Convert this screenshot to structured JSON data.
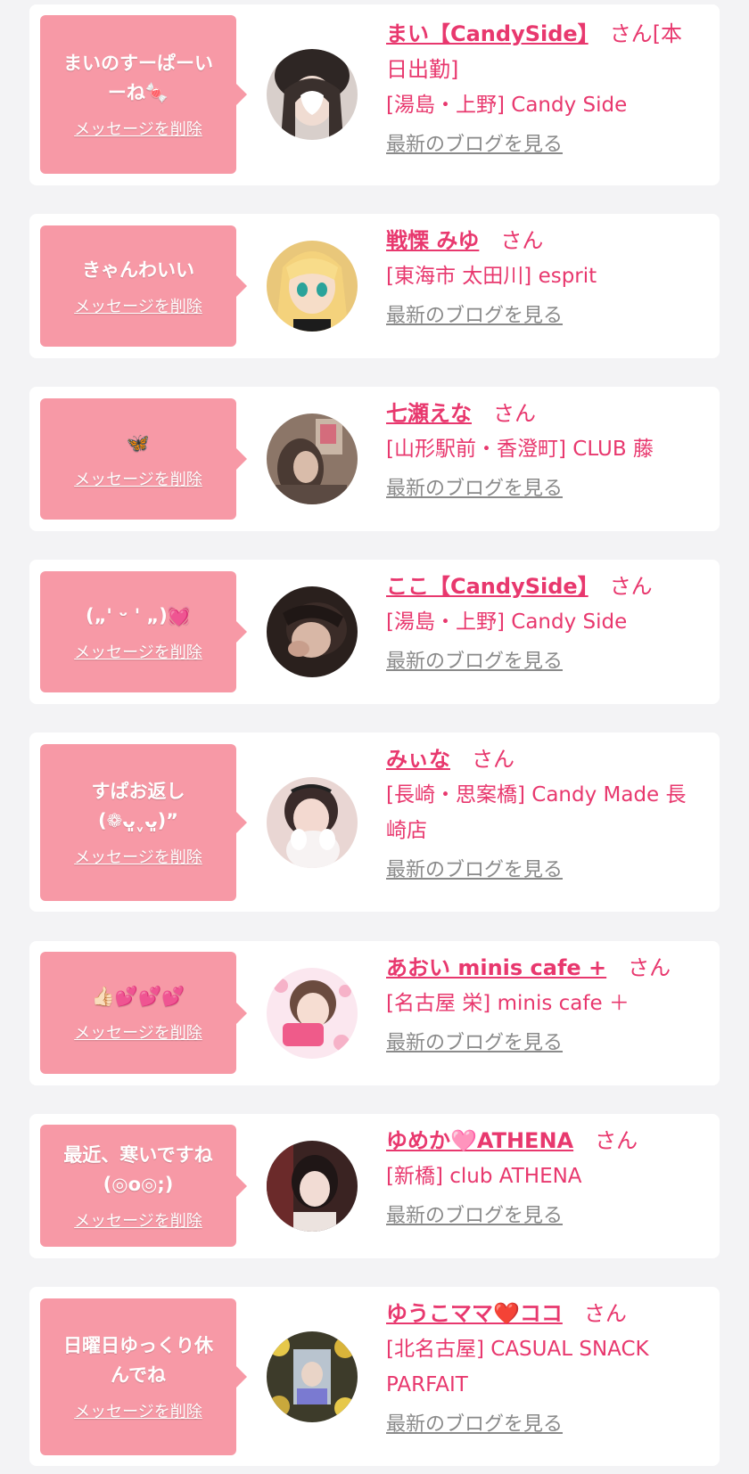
{
  "blog_link_label": "最新のブログを見る",
  "delete_label": "メッセージを削除",
  "honorific": "さん",
  "entries": [
    {
      "message": "まいのすーぱーい\nーね🍬",
      "name": "まい【CandySide】",
      "suffix": "[本日出勤]",
      "shop": "[湯島・上野] Candy Side"
    },
    {
      "message": "きゃんわいい",
      "name": "戦慄 みゆ",
      "suffix": "",
      "shop": "[東海市 太田川] esprit"
    },
    {
      "message": "🦋",
      "name": "七瀬えな",
      "suffix": "",
      "shop": "[山形駅前・香澄町] CLUB 藤"
    },
    {
      "message": "(„' ᵕ ' „)💓",
      "name": "ここ【CandySide】",
      "suffix": "",
      "shop": "[湯島・上野] Candy Side"
    },
    {
      "message": "すぱお返し\n(❁ᴗ͈ˬᴗ͈)”",
      "name": "みぃな",
      "suffix": "",
      "shop": "[長崎・思案橋] Candy Made 長崎店"
    },
    {
      "message": "👍🏻💕💕💕",
      "name": "あおい minis cafe +",
      "suffix": "",
      "shop": "[名古屋 栄] minis cafe ＋"
    },
    {
      "message": "最近、寒いですね\n(◎o◎;)",
      "name": "ゆめか🩷ATHENA",
      "suffix": "",
      "shop": "[新橋] club ATHENA"
    },
    {
      "message": "日曜日ゆっくり休\nんでね",
      "name": "ゆうこママ❤️ココ",
      "suffix": "",
      "shop": "[北名古屋] CASUAL SNACK PARFAIT"
    }
  ]
}
